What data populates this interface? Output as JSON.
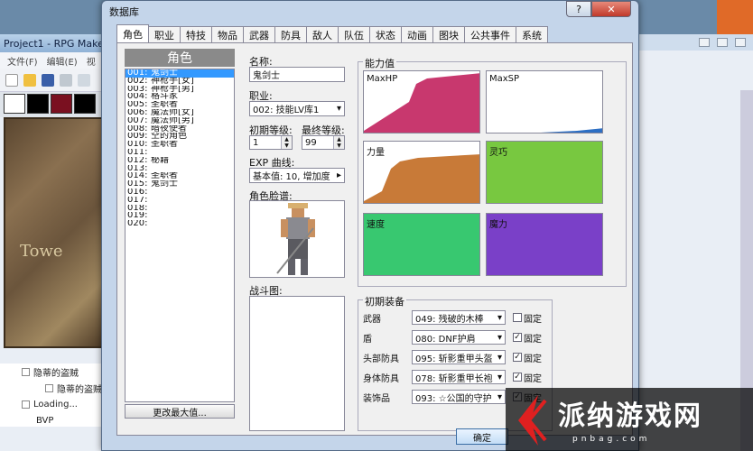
{
  "background_app": {
    "title": "Project1 - RPG Make",
    "menu": [
      "文件(F)",
      "编辑(E)",
      "视"
    ],
    "map_caption": "Towe",
    "tree": [
      "隐蒂的盗贼",
      "隐蒂的盗贼",
      "Loading...",
      "BVP"
    ]
  },
  "dialog": {
    "title": "数据库",
    "help": "?",
    "close": "✕",
    "tabs": [
      "角色",
      "职业",
      "特技",
      "物品",
      "武器",
      "防具",
      "敌人",
      "队伍",
      "状态",
      "动画",
      "图块",
      "公共事件",
      "系统"
    ],
    "active_tab": "角色"
  },
  "actor_list": {
    "header": "角色",
    "items": [
      {
        "num": "001:",
        "name": "鬼剑士"
      },
      {
        "num": "002:",
        "name": "神枪手[女]"
      },
      {
        "num": "003:",
        "name": "神枪手[男]"
      },
      {
        "num": "004:",
        "name": "格斗家"
      },
      {
        "num": "005:",
        "name": "圣职者"
      },
      {
        "num": "006:",
        "name": "魔法师[女]"
      },
      {
        "num": "007:",
        "name": "魔法师[男]"
      },
      {
        "num": "008:",
        "name": "暗夜使者"
      },
      {
        "num": "009:",
        "name": "空的角色"
      },
      {
        "num": "010:",
        "name": "圣职者"
      },
      {
        "num": "011:",
        "name": ""
      },
      {
        "num": "012:",
        "name": "秘籍"
      },
      {
        "num": "013:",
        "name": ""
      },
      {
        "num": "014:",
        "name": "圣职者"
      },
      {
        "num": "015:",
        "name": "鬼剑士"
      },
      {
        "num": "016:",
        "name": ""
      },
      {
        "num": "017:",
        "name": ""
      },
      {
        "num": "018:",
        "name": ""
      },
      {
        "num": "019:",
        "name": ""
      },
      {
        "num": "020:",
        "name": ""
      }
    ],
    "change_max_button": "更改最大值..."
  },
  "fields": {
    "name_label": "名称:",
    "name_value": "鬼剑士",
    "class_label": "职业:",
    "class_value": "002: 技能LV库1",
    "initial_level_label": "初期等级:",
    "initial_level_value": "1",
    "final_level_label": "最终等级:",
    "final_level_value": "99",
    "exp_label": "EXP 曲线:",
    "exp_value": "基本值: 10, 增加度",
    "face_label": "角色脸谱:",
    "battler_label": "战斗图:"
  },
  "params": {
    "title": "能力值",
    "boxes": [
      {
        "label": "MaxHP",
        "color": "#c8386e"
      },
      {
        "label": "MaxSP",
        "color": "#2d6fc4"
      },
      {
        "label": "力量",
        "color": "#c87a38"
      },
      {
        "label": "灵巧",
        "color": "#78c840"
      },
      {
        "label": "速度",
        "color": "#38c870"
      },
      {
        "label": "魔力",
        "color": "#7a40c8"
      }
    ]
  },
  "equipment": {
    "title": "初期装备",
    "fixed_label": "固定",
    "rows": [
      {
        "slot": "武器",
        "value": "049: 残破的木棒",
        "fixed": false
      },
      {
        "slot": "盾",
        "value": "080: DNF护肩",
        "fixed": true
      },
      {
        "slot": "头部防具",
        "value": "095: 斩影重甲头盔",
        "fixed": true
      },
      {
        "slot": "身体防具",
        "value": "078: 斩影重甲长袍",
        "fixed": true
      },
      {
        "slot": "装饰品",
        "value": "093: ☆公国的守护",
        "fixed": true
      }
    ]
  },
  "buttons": {
    "ok": "确定"
  },
  "watermark": {
    "text": "派纳游戏网",
    "sub": "pnbag.com"
  }
}
